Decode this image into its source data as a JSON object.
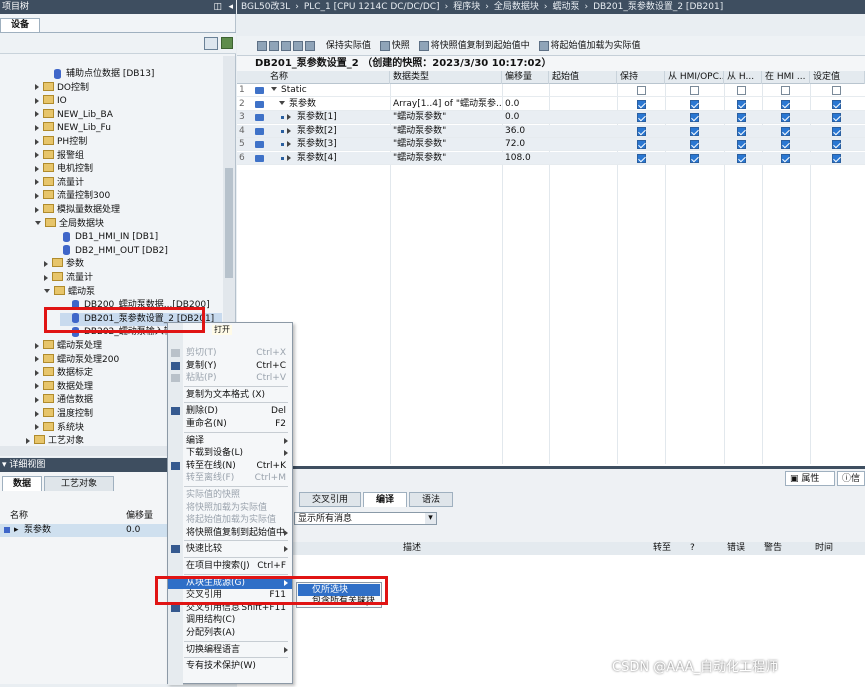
{
  "left_panel": {
    "title": "项目树",
    "tab": "设备",
    "tree": [
      {
        "label": "辅助点位数据 [DB13]",
        "type": "db",
        "indent": 4,
        "expander": "none"
      },
      {
        "label": "DO控制",
        "type": "folder",
        "indent": 3,
        "expander": "closed"
      },
      {
        "label": "IO",
        "type": "folder",
        "indent": 3,
        "expander": "closed"
      },
      {
        "label": "NEW_Lib_BA",
        "type": "folder",
        "indent": 3,
        "expander": "closed"
      },
      {
        "label": "NEW_Lib_Fu",
        "type": "folder",
        "indent": 3,
        "expander": "closed"
      },
      {
        "label": "PH控制",
        "type": "folder",
        "indent": 3,
        "expander": "closed"
      },
      {
        "label": "报警组",
        "type": "folder",
        "indent": 3,
        "expander": "closed"
      },
      {
        "label": "电机控制",
        "type": "folder",
        "indent": 3,
        "expander": "closed"
      },
      {
        "label": "流量计",
        "type": "folder",
        "indent": 3,
        "expander": "closed"
      },
      {
        "label": "流量控制300",
        "type": "folder",
        "indent": 3,
        "expander": "closed"
      },
      {
        "label": "模拟量数据处理",
        "type": "folder",
        "indent": 3,
        "expander": "closed"
      },
      {
        "label": "全局数据块",
        "type": "folder",
        "indent": 3,
        "expander": "open"
      },
      {
        "label": "DB1_HMI_IN [DB1]",
        "type": "db",
        "indent": 5,
        "expander": "none"
      },
      {
        "label": "DB2_HMI_OUT [DB2]",
        "type": "db",
        "indent": 5,
        "expander": "none"
      },
      {
        "label": "参数",
        "type": "folder",
        "indent": 4,
        "expander": "closed"
      },
      {
        "label": "流量计",
        "type": "folder",
        "indent": 4,
        "expander": "closed"
      },
      {
        "label": "蠕动泵",
        "type": "folder",
        "indent": 4,
        "expander": "open"
      },
      {
        "label": "DB200_蠕动泵数据...[DB200]",
        "type": "db",
        "indent": 6,
        "expander": "none"
      },
      {
        "label": "DB201_泵参数设置_2 [DB201]",
        "type": "db",
        "indent": 6,
        "expander": "none",
        "selected": true
      },
      {
        "label": "DB202_蠕动泵输入输出 [DB202]",
        "type": "db",
        "indent": 6,
        "expander": "none"
      },
      {
        "label": "蠕动泵处理",
        "type": "folder",
        "indent": 3,
        "expander": "closed"
      },
      {
        "label": "蠕动泵处理200",
        "type": "folder",
        "indent": 3,
        "expander": "closed"
      },
      {
        "label": "数据标定",
        "type": "folder",
        "indent": 3,
        "expander": "closed"
      },
      {
        "label": "数据处理",
        "type": "folder",
        "indent": 3,
        "expander": "closed"
      },
      {
        "label": "通信数据",
        "type": "folder",
        "indent": 3,
        "expander": "closed"
      },
      {
        "label": "温度控制",
        "type": "folder",
        "indent": 3,
        "expander": "closed"
      },
      {
        "label": "系统块",
        "type": "folder",
        "indent": 3,
        "expander": "closed"
      },
      {
        "label": "工艺对象",
        "type": "folder",
        "indent": 2,
        "expander": "closed"
      }
    ]
  },
  "detail_view": {
    "title": "详细视图",
    "tabs": [
      "数据",
      "工艺对象"
    ],
    "columns": [
      "名称",
      "偏移量"
    ],
    "row": {
      "name": "泵参数",
      "offset": "0.0"
    }
  },
  "breadcrumb": [
    "BGL50改3L",
    "PLC_1 [CPU 1214C DC/DC/DC]",
    "程序块",
    "全局数据块",
    "蠕动泵",
    "DB201_泵参数设置_2 [DB201]"
  ],
  "toolbar": {
    "keep_actual": "保持实际值",
    "snapshot": "快照",
    "copy_snapshot": "将快照值复制到起始值中",
    "load_start": "将起始值加载为实际值"
  },
  "editor": {
    "title": "DB201_泵参数设置_2 （创建的快照：2023/3/30 10:17:02）",
    "columns": [
      "名称",
      "数据类型",
      "偏移量",
      "起始值",
      "保持",
      "从 HMI/OPC...",
      "从 H...",
      "在 HMI ...",
      "设定值"
    ],
    "rows": [
      {
        "num": "1",
        "name": "Static",
        "type": "",
        "offset": "",
        "start": "",
        "checks": [
          false,
          false,
          false,
          false,
          false
        ],
        "level": 0,
        "expander": "open"
      },
      {
        "num": "2",
        "name": "泵参数",
        "type": "Array[1..4] of \"蠕动泵参...",
        "offset": "0.0",
        "start": "",
        "checks": [
          true,
          true,
          true,
          true,
          true
        ],
        "level": 1,
        "expander": "open"
      },
      {
        "num": "3",
        "name": "泵参数[1]",
        "type": "\"蠕动泵参数\"",
        "offset": "0.0",
        "start": "",
        "checks": [
          true,
          true,
          true,
          true,
          true
        ],
        "level": 2,
        "expander": "closed"
      },
      {
        "num": "4",
        "name": "泵参数[2]",
        "type": "\"蠕动泵参数\"",
        "offset": "36.0",
        "start": "",
        "checks": [
          true,
          true,
          true,
          true,
          true
        ],
        "level": 2,
        "expander": "closed"
      },
      {
        "num": "5",
        "name": "泵参数[3]",
        "type": "\"蠕动泵参数\"",
        "offset": "72.0",
        "start": "",
        "checks": [
          true,
          true,
          true,
          true,
          true
        ],
        "level": 2,
        "expander": "closed"
      },
      {
        "num": "6",
        "name": "泵参数[4]",
        "type": "\"蠕动泵参数\"",
        "offset": "108.0",
        "start": "",
        "checks": [
          true,
          true,
          true,
          true,
          true
        ],
        "level": 2,
        "expander": "closed"
      }
    ]
  },
  "inspector": {
    "props": "属性",
    "info": "信",
    "tabs": [
      "交叉引用",
      "编译",
      "语法"
    ],
    "filter_value": "显示所有消息",
    "columns": [
      "描述",
      "转至",
      "?",
      "错误",
      "警告",
      "时间"
    ]
  },
  "context_menu": {
    "tooltip": "打开",
    "items": [
      {
        "label": "剪切(T)",
        "shortcut": "Ctrl+X",
        "disabled": true,
        "icon": "cut-icon"
      },
      {
        "label": "复制(Y)",
        "shortcut": "Ctrl+C",
        "disabled": false,
        "icon": "copy-icon"
      },
      {
        "label": "粘贴(P)",
        "shortcut": "Ctrl+V",
        "disabled": true,
        "icon": "paste-icon"
      },
      {
        "sep": true
      },
      {
        "label": "复制为文本格式 (X)",
        "shortcut": "",
        "disabled": false
      },
      {
        "sep": true
      },
      {
        "label": "删除(D)",
        "shortcut": "Del",
        "disabled": false,
        "icon": "delete-icon"
      },
      {
        "label": "重命名(N)",
        "shortcut": "F2",
        "disabled": false
      },
      {
        "sep": true
      },
      {
        "label": "编译",
        "shortcut": "",
        "submenu": true,
        "disabled": false
      },
      {
        "label": "下载到设备(L)",
        "shortcut": "",
        "submenu": true,
        "disabled": false
      },
      {
        "label": "转至在线(N)",
        "shortcut": "Ctrl+K",
        "disabled": false,
        "icon": "go-online-icon"
      },
      {
        "label": "转至离线(F)",
        "shortcut": "Ctrl+M",
        "disabled": true
      },
      {
        "sep": true
      },
      {
        "label": "实际值的快照",
        "shortcut": "",
        "disabled": true
      },
      {
        "label": "将快照加载为实际值",
        "shortcut": "",
        "disabled": true
      },
      {
        "label": "将起始值加载为实际值",
        "shortcut": "",
        "disabled": true
      },
      {
        "label": "将快照值复制到起始值中",
        "shortcut": "",
        "submenu": true,
        "disabled": false
      },
      {
        "sep": true
      },
      {
        "label": "快速比较",
        "shortcut": "",
        "submenu": true,
        "disabled": false,
        "icon": "compare-icon"
      },
      {
        "sep": true
      },
      {
        "label": "在项目中搜索(J)",
        "shortcut": "Ctrl+F",
        "disabled": false
      },
      {
        "sep": true
      },
      {
        "label": "从块生成源(G)",
        "shortcut": "",
        "submenu": true,
        "disabled": false,
        "highlight": true
      },
      {
        "label": "交叉引用",
        "shortcut": "F11",
        "disabled": false
      },
      {
        "label": "交叉引用信息",
        "shortcut": "Shift+F11",
        "disabled": false,
        "icon": "xref-icon"
      },
      {
        "label": "调用结构(C)",
        "shortcut": "",
        "disabled": false
      },
      {
        "label": "分配列表(A)",
        "shortcut": "",
        "disabled": false
      },
      {
        "sep": true
      },
      {
        "label": "切换编程语言",
        "shortcut": "",
        "submenu": true,
        "disabled": false
      },
      {
        "sep": true
      },
      {
        "label": "专有技术保护(W)",
        "shortcut": "",
        "disabled": false
      }
    ],
    "submenu": [
      "仅所选块",
      "包含所有关联块"
    ]
  },
  "watermark": "CSDN @AAA_自动化工程师"
}
